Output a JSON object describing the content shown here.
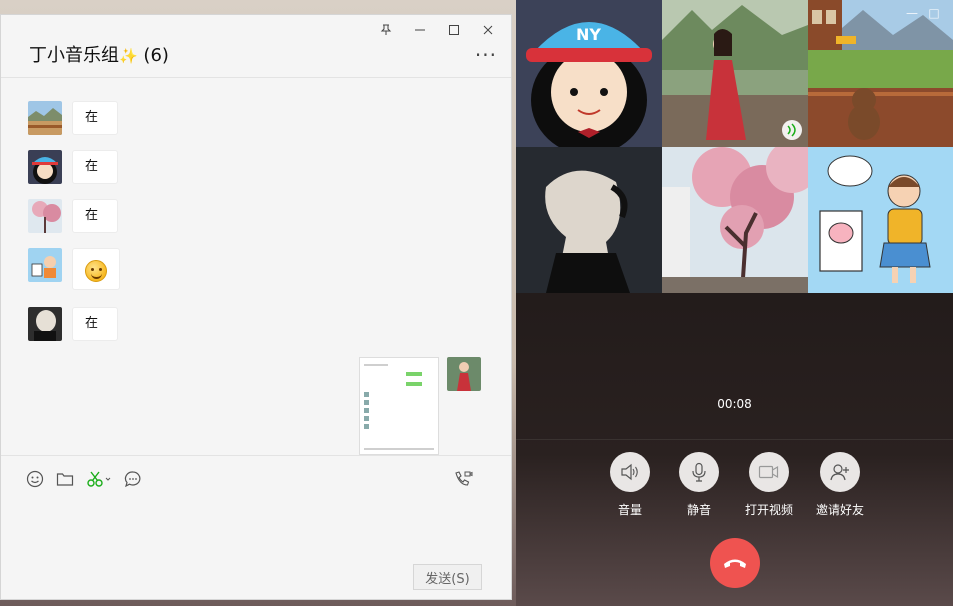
{
  "chat": {
    "title": "丁小音乐组",
    "title_spark": "✨",
    "member_count": "(6)",
    "window_controls": [
      "pin",
      "minimize",
      "maximize",
      "close"
    ],
    "messages": [
      {
        "avatar": "landscape-avatar",
        "text": "在"
      },
      {
        "avatar": "cartoon-girl-avatar",
        "text": "在"
      },
      {
        "avatar": "cherry-blossom-avatar",
        "text": "在"
      },
      {
        "avatar": "pig-cartoon-avatar",
        "text": "smile-emoji"
      },
      {
        "avatar": "blonde-girl-avatar",
        "text": "在"
      }
    ],
    "sent_item": {
      "type": "screenshot-image",
      "avatar": "red-dress-avatar"
    },
    "toolbar": [
      "emoji-icon",
      "folder-icon",
      "scissors-icon",
      "chat-history-icon"
    ],
    "toolbar_right": "video-call-icon",
    "send_label": "发送(S)"
  },
  "call": {
    "timer": "00:08",
    "participants": [
      "cartoon-girl-ny-cap",
      "woman-red-dress",
      "mountain-chalet",
      "blonde-hair-woman",
      "cherry-blossom-tree",
      "pig-illustration"
    ],
    "controls": [
      {
        "icon": "speaker-icon",
        "label": "音量"
      },
      {
        "icon": "microphone-icon",
        "label": "静音"
      },
      {
        "icon": "camera-icon",
        "label": "打开视频"
      },
      {
        "icon": "add-friend-icon",
        "label": "邀请好友"
      }
    ],
    "hangup": "hangup-icon",
    "colors": {
      "hangup": "#ef5350",
      "accent_green": "#1aad19"
    }
  }
}
